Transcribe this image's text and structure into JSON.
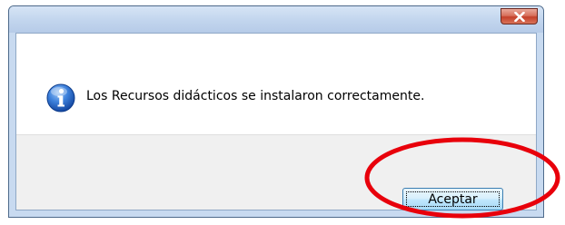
{
  "dialog": {
    "title": "",
    "message": "Los Recursos didácticos se instalaron correctamente.",
    "icon": "info-icon",
    "ok_label": "Aceptar",
    "close_icon": "close-icon"
  },
  "colors": {
    "highlight": "#e8000b",
    "close_button": "#c4402a",
    "titlebar": "#c3d6ee",
    "info_icon": "#1f63c6"
  }
}
